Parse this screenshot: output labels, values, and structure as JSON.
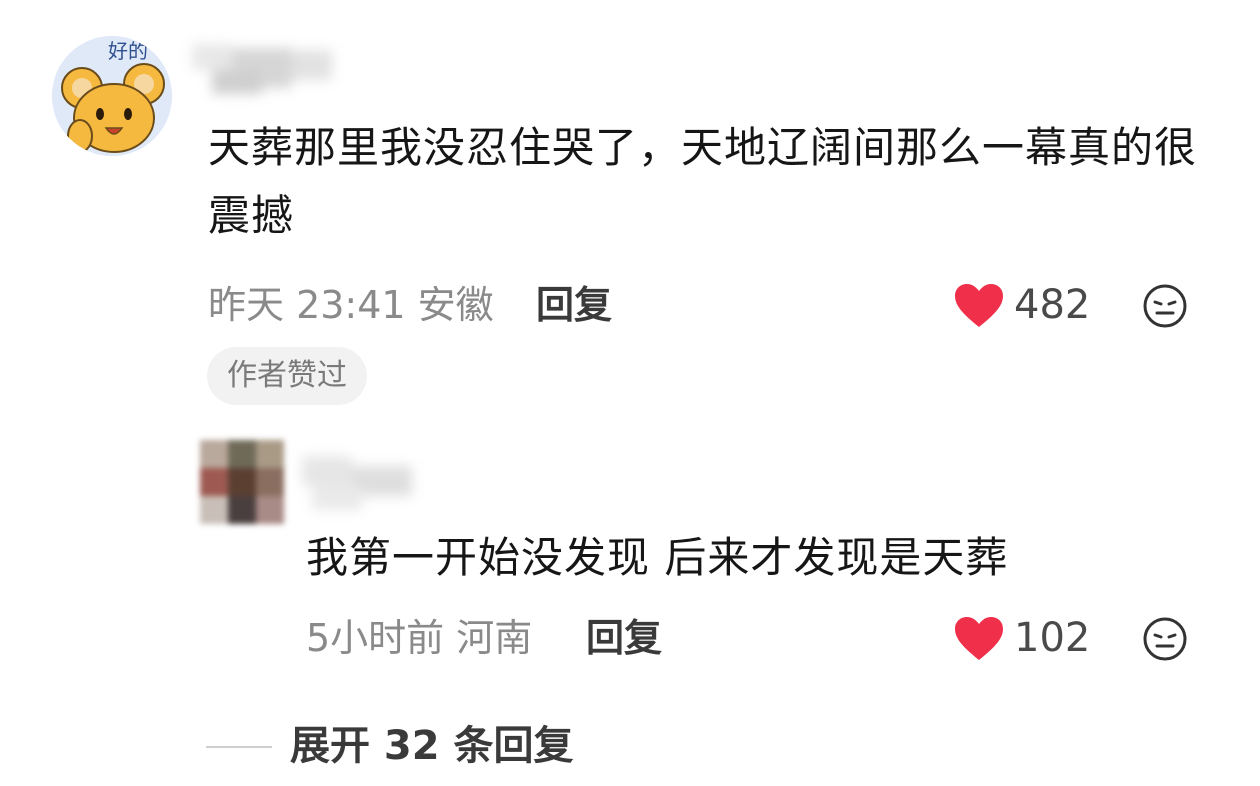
{
  "comment": {
    "text": "天葬那里我没忍住哭了，天地辽阔间那么一幕真的很震撼",
    "time_location": "昨天 23:41 安徽",
    "reply_label": "回复",
    "like_count": "482",
    "author_badge": "作者赞过",
    "avatar_label": "好的",
    "like_color": "#f0304a"
  },
  "reply": {
    "text": "我第一开始没发现 后来才发现是天葬",
    "time_location": "5小时前 河南",
    "reply_label": "回复",
    "like_count": "102"
  },
  "expand": {
    "label": "展开 32 条回复"
  },
  "icons": {
    "like": "heart-icon",
    "emoji": "emoji-neutral-icon"
  }
}
